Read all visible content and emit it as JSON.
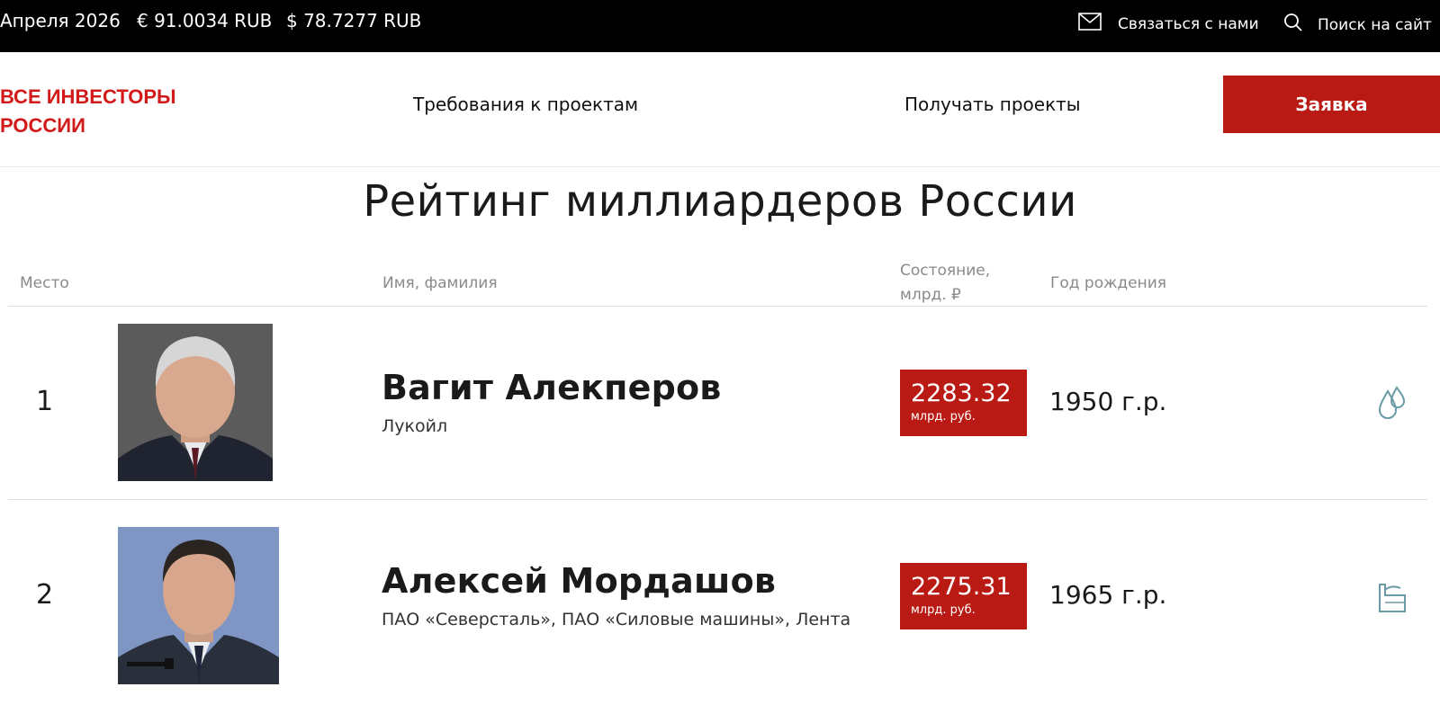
{
  "topbar": {
    "date": "Апреля 2026",
    "eur_rate": "€ 91.0034 RUB",
    "usd_rate": "$ 78.7277 RUB",
    "contact_label": "Связаться с нами",
    "search_label": "Поиск на сайт"
  },
  "header": {
    "logo_line1": "ВСЕ ИНВЕСТОРЫ",
    "logo_line2": "РОССИИ",
    "nav": [
      "Требования к проектам",
      "Получать проекты"
    ],
    "apply_label": "Заявка"
  },
  "page_title": "Рейтинг миллиардеров России",
  "table": {
    "headers": {
      "place": "Место",
      "name": "Имя, фамилия",
      "wealth_line1": "Состояние,",
      "wealth_line2": "млрд. ₽",
      "year": "Год рождения"
    },
    "rows": [
      {
        "rank": "1",
        "name": "Вагит Алекперов",
        "company": "Лукойл",
        "wealth": "2283.32",
        "wealth_unit": "млрд. руб.",
        "year": "1950 г.р.",
        "sector_icon": "oil-drops-icon"
      },
      {
        "rank": "2",
        "name": "Алексей Мордашов",
        "company": "ПАО «Северсталь», ПАО «Силовые машины», Лента",
        "wealth": "2275.31",
        "wealth_unit": "млрд. руб.",
        "year": "1965 г.р.",
        "sector_icon": "factory-icon"
      }
    ]
  },
  "colors": {
    "accent": "#b91b14",
    "logo": "#d21a1a",
    "topbar": "#000000",
    "icon": "#6a9aa6"
  }
}
